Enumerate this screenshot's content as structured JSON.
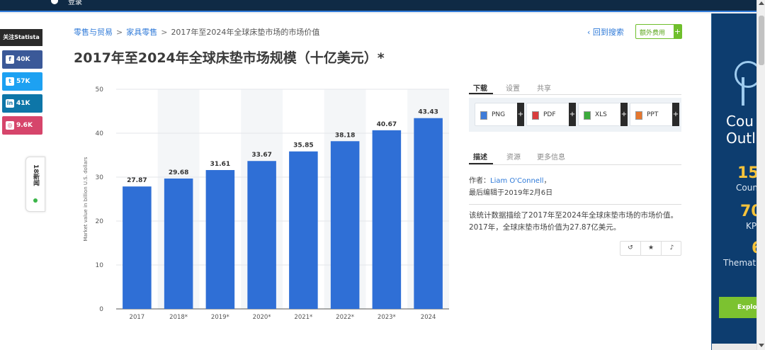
{
  "topbar": {
    "text": "登录"
  },
  "share": {
    "follow_label": "关注Statista",
    "facebook": "40K",
    "twitter": "57K",
    "linkedin": "41K",
    "instagram": "9.6K",
    "news_label": "18新闻"
  },
  "breadcrumb": {
    "level1": "零售与贸易",
    "level2": "家具零售",
    "current": "2017年至2024年全球床垫市场的市场价值",
    "separator": ">"
  },
  "back_link": "‹ 回到搜索",
  "extra_cost": "额外费用",
  "page_title": "2017年至2024年全球床垫市场规模（十亿美元）*",
  "chart_data": {
    "type": "bar",
    "categories": [
      "2017",
      "2018*",
      "2019*",
      "2020*",
      "2021*",
      "2022*",
      "2023*",
      "2024"
    ],
    "values": [
      27.87,
      29.68,
      31.61,
      33.67,
      35.85,
      38.18,
      40.67,
      43.43
    ],
    "ylabel": "Market value in billion U.S. dollars",
    "yticks": [
      0,
      10,
      20,
      30,
      40,
      50
    ],
    "ylim": [
      0,
      50
    ],
    "bar_color": "#2f6fd6",
    "grid": true
  },
  "download_tabs": [
    "下载",
    "设置",
    "共享"
  ],
  "downloads": [
    {
      "label": "PNG",
      "icon": "image-file-icon",
      "color": "#3d7bd9"
    },
    {
      "label": "PDF",
      "icon": "pdf-file-icon",
      "color": "#d93c3c"
    },
    {
      "label": "XLS",
      "icon": "xls-file-icon",
      "color": "#3bab3b"
    },
    {
      "label": "PPT",
      "icon": "ppt-file-icon",
      "color": "#e6772e"
    }
  ],
  "desc_tabs": [
    "描述",
    "资源",
    "更多信息"
  ],
  "author": {
    "prefix": "作者：",
    "name": "Liam O'Connell",
    "suffix": "，",
    "updated": "最后编辑于2019年2月6日"
  },
  "description": "该统计数据描绘了2017年至2024年全球床垫市场的市场价值。2017年，全球床垫市场价值为27.87亿美元。",
  "tools": [
    "history-icon",
    "star-icon",
    "bell-icon"
  ],
  "ad": {
    "title_line1": "Cou",
    "title_line2": "Outl",
    "stat1_num": "15",
    "stat1_label": "Coun",
    "stat2_num": "70",
    "stat2_label": "KP",
    "stat3_num": "6",
    "stat3_label": "Themat",
    "cta": "Explor"
  }
}
